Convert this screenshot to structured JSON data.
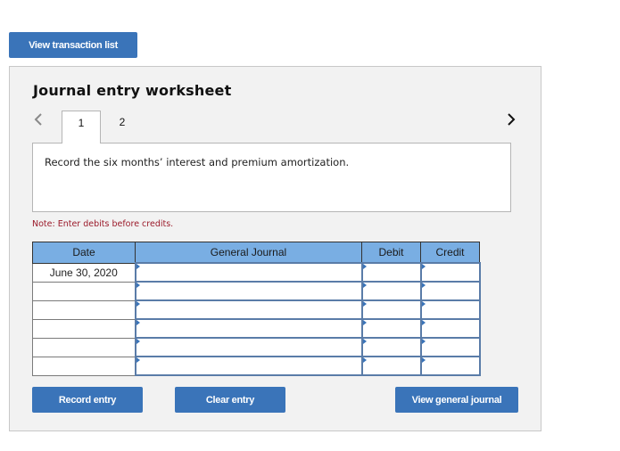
{
  "top_button": {
    "label": "View transaction list"
  },
  "worksheet": {
    "title": "Journal entry worksheet",
    "nav": {
      "prev_icon": "chevron-left-icon",
      "next_icon": "chevron-right-icon"
    },
    "tabs": [
      {
        "label": "1",
        "active": true
      },
      {
        "label": "2",
        "active": false
      }
    ],
    "description": "Record the six months’ interest and premium amortization.",
    "note": "Note: Enter debits before credits.",
    "table": {
      "headers": [
        "Date",
        "General Journal",
        "Debit",
        "Credit"
      ],
      "rows": [
        {
          "date": "June 30, 2020",
          "account": "",
          "debit": "",
          "credit": ""
        },
        {
          "date": "",
          "account": "",
          "debit": "",
          "credit": ""
        },
        {
          "date": "",
          "account": "",
          "debit": "",
          "credit": ""
        },
        {
          "date": "",
          "account": "",
          "debit": "",
          "credit": ""
        },
        {
          "date": "",
          "account": "",
          "debit": "",
          "credit": ""
        },
        {
          "date": "",
          "account": "",
          "debit": "",
          "credit": ""
        }
      ]
    },
    "buttons": {
      "record": "Record entry",
      "clear": "Clear entry",
      "view_journal": "View general journal"
    }
  },
  "colors": {
    "button_blue": "#3a74b9",
    "header_blue": "#79aee3",
    "note_red": "#9b1a2a",
    "panel_bg": "#f2f2f2"
  }
}
